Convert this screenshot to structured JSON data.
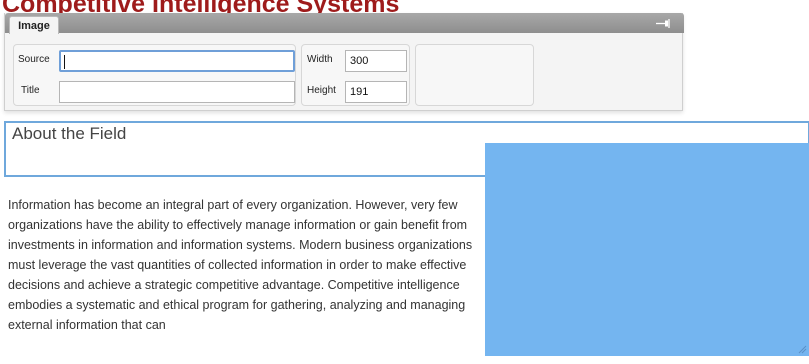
{
  "page": {
    "heading": "Competitive Intelligence Systems"
  },
  "dialog": {
    "tab_label": "Image",
    "pin_icon": "pin-icon",
    "source_label": "Source",
    "source_value": "",
    "title_label": "Title",
    "title_value": "",
    "width_label": "Width",
    "width_value": "300",
    "height_label": "Height",
    "height_value": "191"
  },
  "section": {
    "heading": "About the Field"
  },
  "body": {
    "paragraph": "Information has become an integral part of every organization. However, very few organizations have the ability to effectively manage information or gain benefit from investments in information and information systems. Modern business organizations must leverage the vast quantities of collected information in order to make effective decisions and achieve a strategic competitive advantage. Competitive intelligence embodies a systematic and ethical program for gathering, analyzing and managing external information that can"
  },
  "image": {
    "fill_color": "#74b5f0",
    "resize_icon": "resize-handle-icon"
  }
}
